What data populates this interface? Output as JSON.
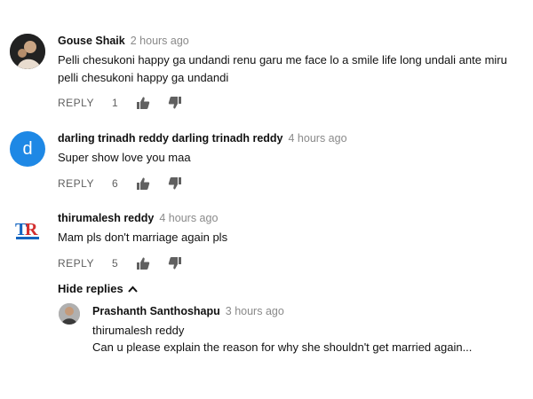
{
  "comments": [
    {
      "author": "Gouse Shaik",
      "time": "2 hours ago",
      "lines": [
        "Pelli chesukoni happy ga undandi renu garu me face lo a smile life long undali ante miru",
        "pelli chesukoni happy ga undandi"
      ],
      "reply_label": "REPLY",
      "likes": "1",
      "avatar_icon": "profile-photo"
    },
    {
      "author": "darling trinadh reddy darling trinadh reddy",
      "time": "4 hours ago",
      "lines": [
        "Super show love you maa"
      ],
      "reply_label": "REPLY",
      "likes": "6",
      "avatar_letter": "d",
      "avatar_color": "#1e88e5"
    },
    {
      "author": "thirumalesh reddy",
      "time": "4 hours ago",
      "lines": [
        "Mam pls don't marriage again pls"
      ],
      "reply_label": "REPLY",
      "likes": "5",
      "avatar_icon": "tr-logo"
    }
  ],
  "hide_replies_label": "Hide replies",
  "reply": {
    "author": "Prashanth Santhoshapu",
    "time": "3 hours ago",
    "lines": [
      "thirumalesh reddy",
      "Can u please explain the reason for why she shouldn't get married again..."
    ],
    "avatar_icon": "profile-photo"
  },
  "colors": {
    "meta_gray": "#8a8a8a",
    "action_gray": "#606060",
    "logo_red": "#d32f2f",
    "logo_blue": "#1565c0"
  }
}
